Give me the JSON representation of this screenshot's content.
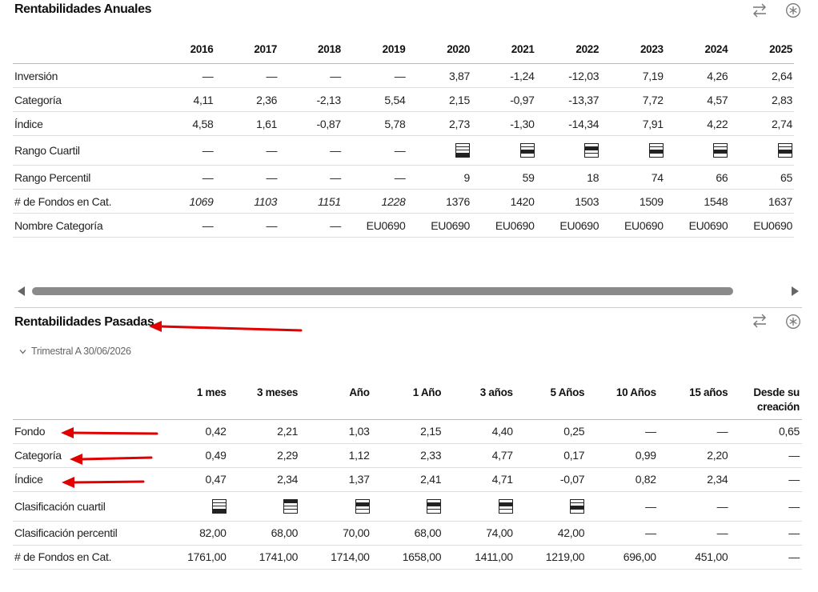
{
  "annual": {
    "title": "Rentabilidades Anuales",
    "years": [
      "2016",
      "2017",
      "2018",
      "2019",
      "2020",
      "2021",
      "2022",
      "2023",
      "2024",
      "2025"
    ],
    "rows": [
      {
        "label": "Inversión",
        "values": [
          "—",
          "—",
          "—",
          "—",
          "3,87",
          "-1,24",
          "-12,03",
          "7,19",
          "4,26",
          "2,64"
        ]
      },
      {
        "label": "Categoría",
        "values": [
          "4,11",
          "2,36",
          "-2,13",
          "5,54",
          "2,15",
          "-0,97",
          "-13,37",
          "7,72",
          "4,57",
          "2,83"
        ]
      },
      {
        "label": "Índice",
        "values": [
          "4,58",
          "1,61",
          "-0,87",
          "5,78",
          "2,73",
          "-1,30",
          "-14,34",
          "7,91",
          "4,22",
          "2,74"
        ]
      },
      {
        "label": "Rango Cuartil",
        "values": [
          "—",
          "—",
          "—",
          "—",
          "Q4",
          "Q3",
          "Q2",
          "Q3",
          "Q3",
          "Q3"
        ],
        "quartile": true
      },
      {
        "label": "Rango Percentil",
        "values": [
          "—",
          "—",
          "—",
          "—",
          "9",
          "59",
          "18",
          "74",
          "66",
          "65"
        ]
      },
      {
        "label": "# de Fondos en Cat.",
        "values": [
          "1069",
          "1103",
          "1151",
          "1228",
          "1376",
          "1420",
          "1503",
          "1509",
          "1548",
          "1637"
        ],
        "italic_count": 4
      },
      {
        "label": "Nombre Categoría",
        "values": [
          "—",
          "—",
          "—",
          "EU0690",
          "EU0690",
          "EU0690",
          "EU0690",
          "EU0690",
          "EU0690",
          "EU0690"
        ]
      }
    ]
  },
  "past": {
    "title": "Rentabilidades Pasadas",
    "period": "Trimestral A 30/06/2026",
    "columns": [
      "1 mes",
      "3 meses",
      "Año",
      "1 Año",
      "3 años",
      "5 Años",
      "10 Años",
      "15 años",
      "Desde su creación"
    ],
    "rows": [
      {
        "label": "Fondo",
        "values": [
          "0,42",
          "2,21",
          "1,03",
          "2,15",
          "4,40",
          "0,25",
          "—",
          "—",
          "0,65"
        ]
      },
      {
        "label": "Categoría",
        "values": [
          "0,49",
          "2,29",
          "1,12",
          "2,33",
          "4,77",
          "0,17",
          "0,99",
          "2,20",
          "—"
        ]
      },
      {
        "label": "Índice",
        "values": [
          "0,47",
          "2,34",
          "1,37",
          "2,41",
          "4,71",
          "-0,07",
          "0,82",
          "2,34",
          "—"
        ]
      },
      {
        "label": "Clasificación cuartil",
        "values": [
          "Q4",
          "Q1",
          "Q2",
          "Q2",
          "Q2",
          "Q3",
          "—",
          "—",
          "—"
        ],
        "quartile": true
      },
      {
        "label": "Clasificación percentil",
        "values": [
          "82,00",
          "68,00",
          "70,00",
          "68,00",
          "74,00",
          "42,00",
          "—",
          "—",
          "—"
        ]
      },
      {
        "label": "# de Fondos en Cat.",
        "values": [
          "1761,00",
          "1741,00",
          "1714,00",
          "1658,00",
          "1411,00",
          "1219,00",
          "696,00",
          "451,00",
          "—"
        ]
      }
    ]
  },
  "icons": {
    "swap": "swap-arrows-icon",
    "settings": "asterisk-circle-icon",
    "expand": "chevron-down-icon"
  },
  "colors": {
    "annotation_arrow": "#e00000"
  }
}
